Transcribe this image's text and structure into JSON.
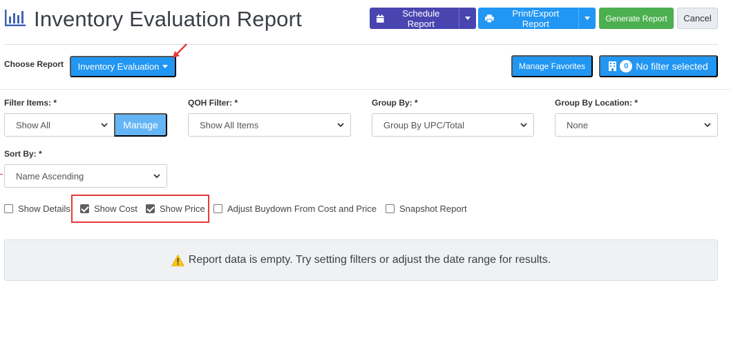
{
  "header": {
    "title": "Inventory Evaluation Report",
    "schedule_label": "Schedule Report",
    "print_label": "Print/Export Report",
    "generate_label": "Generate Report",
    "cancel_label": "Cancel"
  },
  "choose": {
    "label": "Choose Report",
    "selected": "Inventory Evaluation"
  },
  "favorites_label": "Manage Favorites",
  "filter": {
    "count": "0",
    "label": "No filter selected"
  },
  "fields": {
    "filter_items": {
      "label": "Filter Items: *",
      "value": "Show All",
      "manage_label": "Manage"
    },
    "qoh_filter": {
      "label": "QOH Filter: *",
      "value": "Show All Items"
    },
    "group_by": {
      "label": "Group By: *",
      "value": "Group By UPC/Total"
    },
    "group_by_location": {
      "label": "Group By Location: *",
      "value": "None"
    },
    "sort_by": {
      "label": "Sort By: *",
      "value": "Name Ascending"
    }
  },
  "checkboxes": {
    "show_details": {
      "label": "Show Details",
      "checked": false
    },
    "show_cost": {
      "label": "Show Cost",
      "checked": true
    },
    "show_price": {
      "label": "Show Price",
      "checked": true
    },
    "adjust_buydown": {
      "label": "Adjust Buydown From Cost and Price",
      "checked": false
    },
    "snapshot": {
      "label": "Snapshot Report",
      "checked": false
    }
  },
  "alert": {
    "text": "Report data is empty. Try setting filters or adjust the date range for results."
  },
  "colors": {
    "purple": "#4845b0",
    "blue": "#2196f3",
    "green": "#4caf50",
    "annotation_red": "#e53935",
    "warning_yellow": "#f5c518"
  },
  "icons": {
    "title": "bar-chart-icon",
    "schedule": "calendar-icon",
    "print": "printer-icon",
    "filter": "building-icon",
    "alert": "warning-icon"
  }
}
